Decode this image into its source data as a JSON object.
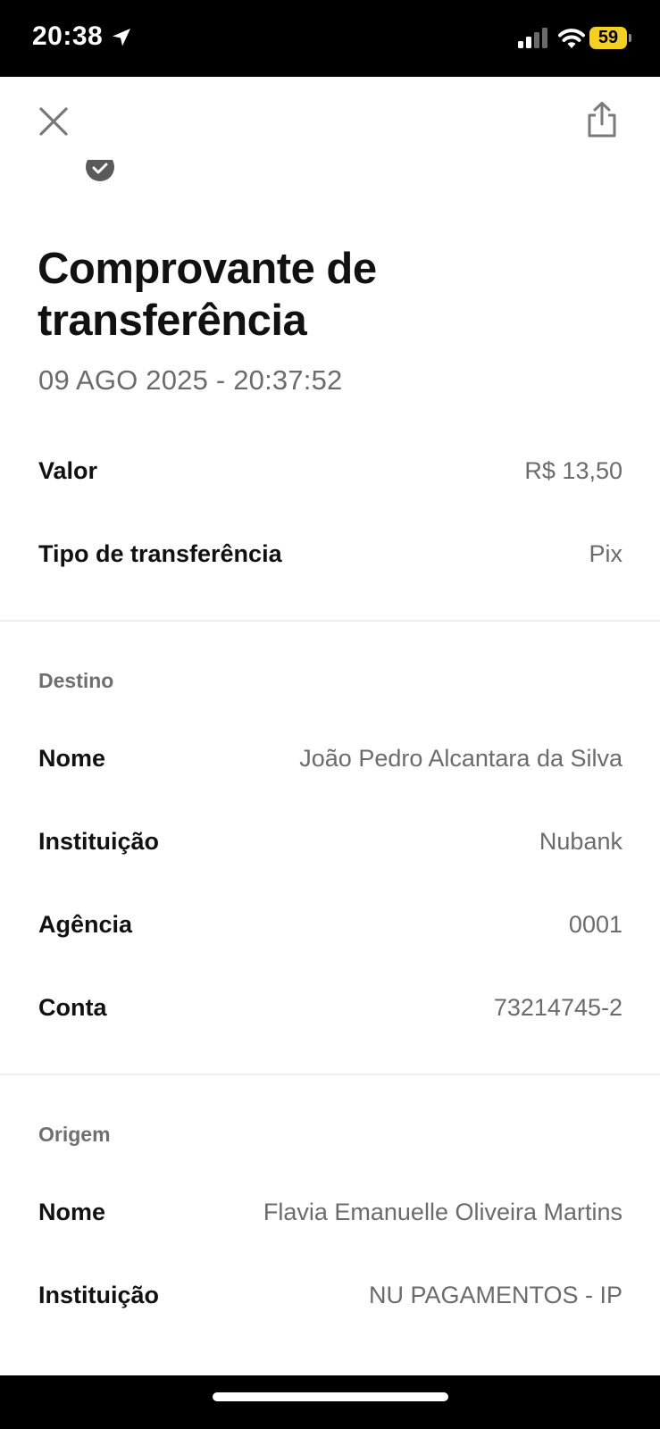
{
  "status_bar": {
    "time": "20:38",
    "battery_level": "59",
    "battery_color": "#f5d020",
    "icons": [
      "location-arrow-icon",
      "signal-icon",
      "wifi-icon",
      "battery-icon"
    ]
  },
  "header": {
    "close_icon": "close-icon",
    "share_icon": "share-icon",
    "badge_icon": "check-circle-icon"
  },
  "receipt": {
    "title": "Comprovante de transferência",
    "datetime": "09 AGO 2025 - 20:37:52",
    "summary": [
      {
        "label": "Valor",
        "value": "R$ 13,50"
      },
      {
        "label": "Tipo de transferência",
        "value": "Pix"
      }
    ],
    "destination": {
      "section_title": "Destino",
      "rows": [
        {
          "label": "Nome",
          "value": "João Pedro Alcantara da Silva"
        },
        {
          "label": "Instituição",
          "value": "Nubank"
        },
        {
          "label": "Agência",
          "value": "0001"
        },
        {
          "label": "Conta",
          "value": "73214745-2"
        }
      ]
    },
    "origin": {
      "section_title": "Origem",
      "rows": [
        {
          "label": "Nome",
          "value": "Flavia Emanuelle Oliveira Martins"
        },
        {
          "label": "Instituição",
          "value": "NU PAGAMENTOS - IP"
        }
      ]
    }
  }
}
